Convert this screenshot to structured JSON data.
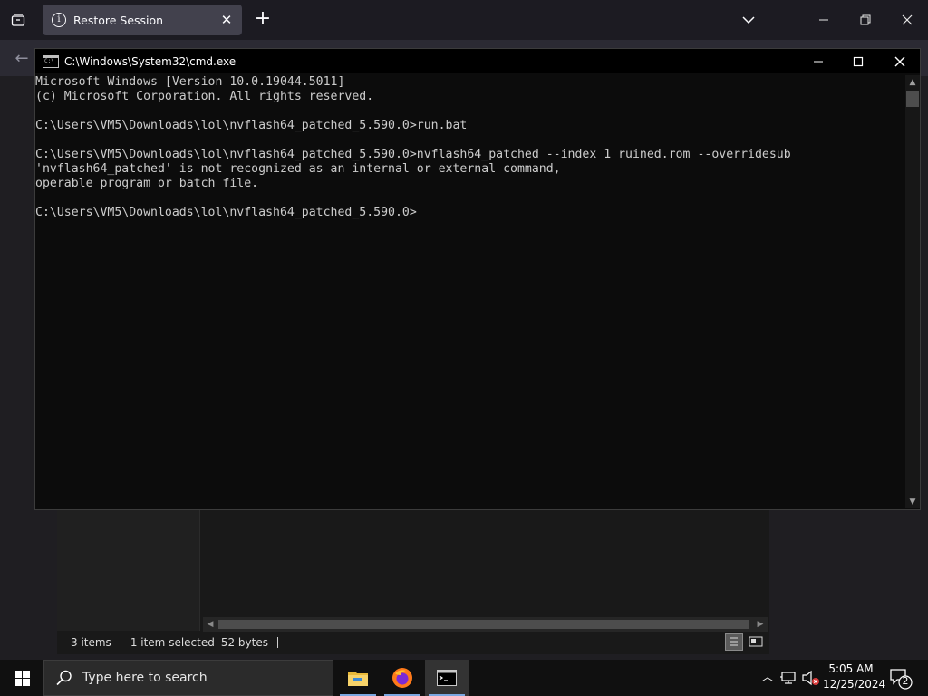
{
  "browser": {
    "tab": {
      "title": "Restore Session",
      "close_glyph": "✕",
      "info_glyph": "i"
    },
    "new_tab_glyph": "+",
    "icons": [
      "tab-overview-icon",
      "info-icon",
      "close-icon",
      "plus-icon",
      "chevron-down-icon",
      "minimize-icon",
      "restore-icon",
      "close-icon",
      "back-arrow-icon"
    ]
  },
  "cmd": {
    "title": "C:\\Windows\\System32\\cmd.exe",
    "lines": [
      "Microsoft Windows [Version 10.0.19044.5011]",
      "(c) Microsoft Corporation. All rights reserved.",
      "",
      "C:\\Users\\VM5\\Downloads\\lol\\nvflash64_patched_5.590.0>run.bat",
      "",
      "C:\\Users\\VM5\\Downloads\\lol\\nvflash64_patched_5.590.0>nvflash64_patched --index 1 ruined.rom --overridesub",
      "'nvflash64_patched' is not recognized as an internal or external command,",
      "operable program or batch file.",
      "",
      "C:\\Users\\VM5\\Downloads\\lol\\nvflash64_patched_5.590.0>"
    ]
  },
  "explorer": {
    "status": {
      "items": "3 items",
      "selected": "1 item selected",
      "size": "52 bytes"
    }
  },
  "taskbar": {
    "search_placeholder": "Type here to search",
    "apps": [
      "file-explorer-icon",
      "firefox-icon",
      "command-prompt-icon"
    ],
    "clock": {
      "time": "5:05 AM",
      "date": "12/25/2024"
    },
    "notification_count": "2"
  },
  "colors": {
    "console_bg": "#0c0c0c",
    "console_text": "#cccccc",
    "taskbar_bg": "#101010",
    "firefox_tab_bg": "#42414d"
  }
}
